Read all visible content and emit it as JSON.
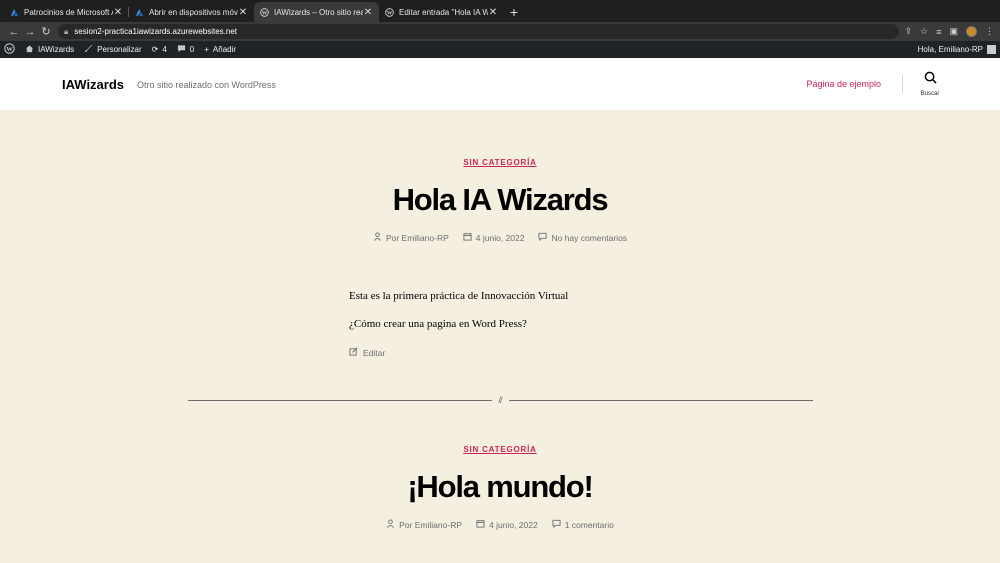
{
  "browser": {
    "tabs": [
      {
        "title": "Patrocinios de Microsoft Azure",
        "active": false
      },
      {
        "title": "Abrir en dispositivos móviles -",
        "active": false
      },
      {
        "title": "IAWizards – Otro sitio realizado",
        "active": true
      },
      {
        "title": "Editar entrada \"Hola IA Wizards",
        "active": false
      }
    ],
    "close_glyph": "✕",
    "new_tab_glyph": "+",
    "url": "sesion2-practica1iawizards.azurewebsites.net"
  },
  "adminbar": {
    "site": "IAWizards",
    "customize": "Personalizar",
    "updates_count": "4",
    "comments_count": "0",
    "new": "Añadir",
    "greeting": "Hola, Emiliano-RP"
  },
  "header": {
    "site_title": "IAWizards",
    "description": "Otro sitio realizado con WordPress",
    "menu_item": "Página de ejemplo",
    "search_label": "Buscar"
  },
  "posts": [
    {
      "category": "SIN CATEGORÍA",
      "title": "Hola IA Wizards",
      "author": "Por Emiliano-RP",
      "date": "4 junio, 2022",
      "comments": "No hay comentarios",
      "paragraphs": [
        "Esta es la primera práctica de Innovacción Virtual",
        "¿Cómo crear una pagina en Word Press?"
      ],
      "edit": "Editar"
    },
    {
      "category": "SIN CATEGORÍA",
      "title": "¡Hola mundo!",
      "author": "Por Emiliano-RP",
      "date": "4 junio, 2022",
      "comments": "1 comentario"
    }
  ],
  "separator_mark": "//",
  "colors": {
    "accent": "#cd2653",
    "background": "#f5efe0",
    "adminbar": "#1d2327"
  }
}
